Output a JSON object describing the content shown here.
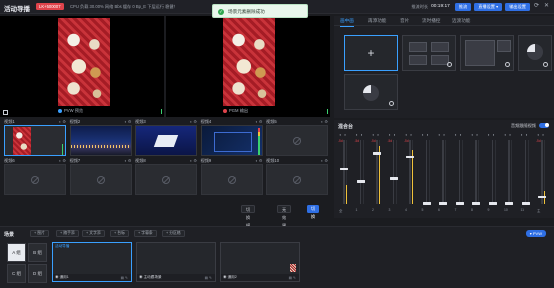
{
  "header": {
    "title": "活动导播",
    "live_badge": "LK+500007",
    "stats": "CPU 负载 30.00%  网络 Bbs  缓存 0 Bp_E  下层运行 稳健！",
    "timer_label": "推流时长",
    "timer": "00:19:17",
    "btn_push": "推流",
    "btn_settings": "直播设置 ▾",
    "btn_output": "输出设置",
    "icon_refresh": "refresh-icon",
    "icon_close": "close-icon"
  },
  "toast": {
    "message": "场景元素删除成功"
  },
  "monitors": {
    "pvw_label": "PVW 预览",
    "pgm_label": "PGM 输出"
  },
  "sources": [
    {
      "name": "视频1",
      "kind": "food"
    },
    {
      "name": "视频2",
      "badge": "2",
      "kind": "night"
    },
    {
      "name": "视频3",
      "badge": "3",
      "kind": "slide"
    },
    {
      "name": "视频4",
      "badge": "4",
      "kind": "slide2"
    },
    {
      "name": "视频5",
      "kind": "empty"
    },
    {
      "name": "视频6",
      "kind": "empty"
    },
    {
      "name": "视频7",
      "kind": "empty"
    },
    {
      "name": "视频8",
      "kind": "empty"
    },
    {
      "name": "视频9",
      "kind": "empty"
    },
    {
      "name": "视频10",
      "kind": "empty"
    }
  ],
  "controls": {
    "transition": "切换模式 ▾",
    "effect": "无效果 ▾",
    "switch": "切换"
  },
  "right_tabs": [
    "画中画",
    "再添功能",
    "音片",
    "流时播控",
    "迈渡功能"
  ],
  "mixer": {
    "title": "混合台",
    "follow_label": "音频跟随视频",
    "channels": [
      {
        "name": "全",
        "db": "-5d",
        "level": 0.55,
        "meter": 0.3
      },
      {
        "name": "1",
        "db": "-5d",
        "level": 0.35,
        "meter": 0.0
      },
      {
        "name": "2",
        "db": "-5d",
        "level": 0.8,
        "meter": 0.9
      },
      {
        "name": "3",
        "db": "-5d",
        "level": 0.4,
        "meter": 0.0
      },
      {
        "name": "4",
        "db": "-5d",
        "level": 0.75,
        "meter": 0.85
      },
      {
        "name": "5",
        "db": "",
        "level": 0.0,
        "meter": 0.0
      },
      {
        "name": "6",
        "db": "",
        "level": 0.0,
        "meter": 0.0
      },
      {
        "name": "7",
        "db": "",
        "level": 0.0,
        "meter": 0.0
      },
      {
        "name": "8",
        "db": "",
        "level": 0.0,
        "meter": 0.0
      },
      {
        "name": "9",
        "db": "",
        "level": 0.0,
        "meter": 0.0
      },
      {
        "name": "10",
        "db": "",
        "level": 0.0,
        "meter": 0.0
      },
      {
        "name": "11",
        "db": "",
        "level": 0.0,
        "meter": 0.0
      },
      {
        "name": "主",
        "db": "-5d",
        "level": 0.1,
        "meter": 0.2
      }
    ]
  },
  "scenes": {
    "title": "场景",
    "tools": [
      "图片",
      "随手添",
      "文字添",
      "台标",
      "字幕条",
      "分区格"
    ],
    "pvw_btn": "▾ PVW",
    "abc": [
      "A 组",
      "B 组",
      "C 组",
      "D 组"
    ],
    "cards": [
      {
        "top": "活动导播",
        "name": "通用1"
      },
      {
        "name": "主动跟场景"
      },
      {
        "name": "通用2"
      }
    ]
  },
  "colors": {
    "accent": "#3aa0ff",
    "primary_btn": "#2f6fe4",
    "live": "#e0434b",
    "meter": "#f0c23a"
  }
}
